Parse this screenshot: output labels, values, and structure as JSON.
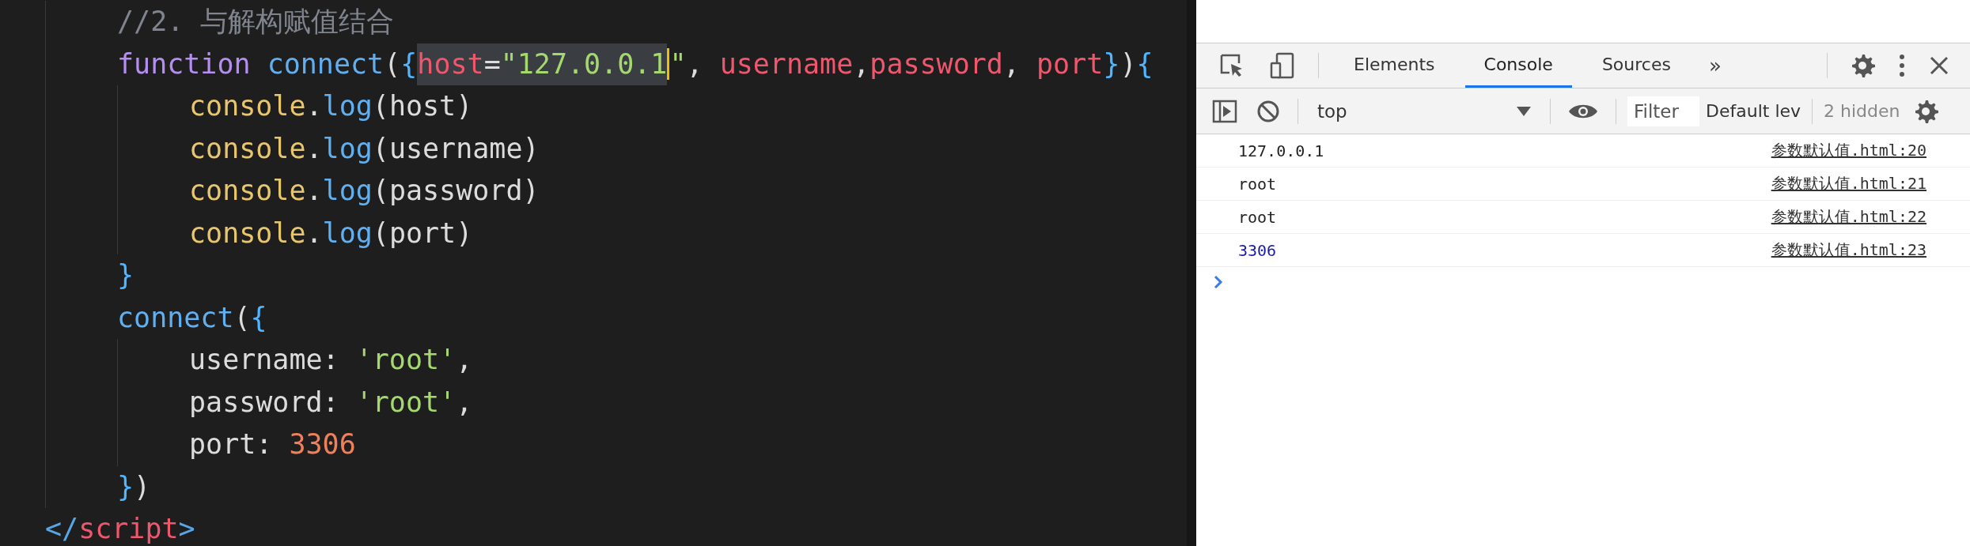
{
  "editor": {
    "lines": [
      {
        "children": [
          {
            "tokens": [
              {
                "kind": "comment",
                "text": "//2. 与解构赋值结合"
              }
            ]
          },
          {
            "tokens": [
              {
                "kind": "keyword",
                "text": "function "
              },
              {
                "kind": "function",
                "text": "connect"
              },
              {
                "kind": "plain",
                "text": "("
              },
              {
                "kind": "brace",
                "text": "{"
              },
              {
                "kind": "param",
                "text": "host",
                "highlighted": true
              },
              {
                "kind": "plain",
                "text": "=",
                "highlighted": true
              },
              {
                "kind": "string",
                "text": "\"127.0.0.1",
                "highlighted": true,
                "cursor": true
              },
              {
                "kind": "string",
                "text": "\""
              },
              {
                "kind": "plain",
                "text": ", "
              },
              {
                "kind": "param",
                "text": "username"
              },
              {
                "kind": "plain",
                "text": ","
              },
              {
                "kind": "param",
                "text": "password"
              },
              {
                "kind": "plain",
                "text": ", "
              },
              {
                "kind": "param",
                "text": "port"
              },
              {
                "kind": "brace",
                "text": "}"
              },
              {
                "kind": "plain",
                "text": ")"
              },
              {
                "kind": "brace",
                "text": "{"
              }
            ],
            "children": [
              {
                "tokens": [
                  {
                    "kind": "object",
                    "text": "console"
                  },
                  {
                    "kind": "plain",
                    "text": "."
                  },
                  {
                    "kind": "function",
                    "text": "log"
                  },
                  {
                    "kind": "plain",
                    "text": "(host)"
                  }
                ]
              },
              {
                "tokens": [
                  {
                    "kind": "object",
                    "text": "console"
                  },
                  {
                    "kind": "plain",
                    "text": "."
                  },
                  {
                    "kind": "function",
                    "text": "log"
                  },
                  {
                    "kind": "plain",
                    "text": "(username)"
                  }
                ]
              },
              {
                "tokens": [
                  {
                    "kind": "object",
                    "text": "console"
                  },
                  {
                    "kind": "plain",
                    "text": "."
                  },
                  {
                    "kind": "function",
                    "text": "log"
                  },
                  {
                    "kind": "plain",
                    "text": "(password)"
                  }
                ]
              },
              {
                "tokens": [
                  {
                    "kind": "object",
                    "text": "console"
                  },
                  {
                    "kind": "plain",
                    "text": "."
                  },
                  {
                    "kind": "function",
                    "text": "log"
                  },
                  {
                    "kind": "plain",
                    "text": "(port)"
                  }
                ]
              }
            ]
          },
          {
            "tokens": [
              {
                "kind": "brace",
                "text": "}"
              }
            ]
          },
          {
            "tokens": [
              {
                "kind": "function",
                "text": "connect"
              },
              {
                "kind": "plain",
                "text": "("
              },
              {
                "kind": "brace",
                "text": "{"
              }
            ],
            "children": [
              {
                "tokens": [
                  {
                    "kind": "plain",
                    "text": "username: "
                  },
                  {
                    "kind": "string",
                    "text": "'root'"
                  },
                  {
                    "kind": "plain",
                    "text": ","
                  }
                ]
              },
              {
                "tokens": [
                  {
                    "kind": "plain",
                    "text": "password: "
                  },
                  {
                    "kind": "string",
                    "text": "'root'"
                  },
                  {
                    "kind": "plain",
                    "text": ","
                  }
                ]
              },
              {
                "tokens": [
                  {
                    "kind": "plain",
                    "text": "port: "
                  },
                  {
                    "kind": "number",
                    "text": "3306"
                  }
                ]
              }
            ]
          },
          {
            "tokens": [
              {
                "kind": "brace",
                "text": "}"
              },
              {
                "kind": "plain",
                "text": ")"
              }
            ]
          }
        ]
      },
      {
        "tokens": [
          {
            "kind": "tagpunct",
            "text": "</"
          },
          {
            "kind": "tag",
            "text": "script"
          },
          {
            "kind": "tagpunct",
            "text": ">"
          }
        ]
      }
    ]
  },
  "devtools": {
    "tabs": [
      {
        "label": "Elements",
        "selected": false
      },
      {
        "label": "Console",
        "selected": true
      },
      {
        "label": "Sources",
        "selected": false
      }
    ],
    "more_tabs": "»",
    "context": "top",
    "filter": {
      "placeholder": "Filter"
    },
    "levels": "Default lev",
    "hidden_count": "2 hidden",
    "messages": [
      {
        "kind": "string",
        "text": "127.0.0.1",
        "source": "参数默认值.html:20"
      },
      {
        "kind": "string",
        "text": "root",
        "source": "参数默认值.html:21"
      },
      {
        "kind": "string",
        "text": "root",
        "source": "参数默认值.html:22"
      },
      {
        "kind": "number",
        "text": "3306",
        "source": "参数默认值.html:23"
      }
    ]
  }
}
